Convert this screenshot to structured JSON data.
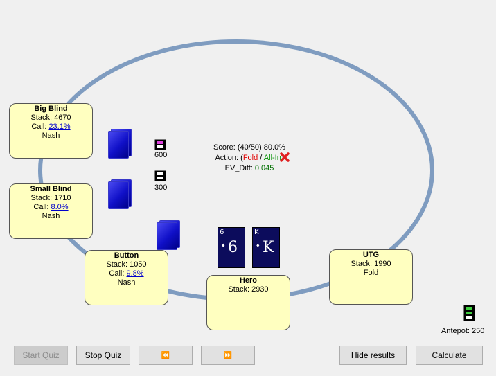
{
  "seats": {
    "big_blind": {
      "name": "Big Blind",
      "stack": "Stack: 4670",
      "call_label": "Call:",
      "call_pct": "23.1%",
      "strategy": "Nash"
    },
    "small_blind": {
      "name": "Small Blind",
      "stack": "Stack: 1710",
      "call_label": "Call:",
      "call_pct": "8.0%",
      "strategy": "Nash"
    },
    "button": {
      "name": "Button",
      "stack": "Stack: 1050",
      "call_label": "Call:",
      "call_pct": "9.8%",
      "strategy": "Nash"
    },
    "hero": {
      "name": "Hero",
      "stack": "Stack: 2930"
    },
    "utg": {
      "name": "UTG",
      "stack": "Stack: 1990",
      "action": "Fold"
    }
  },
  "bets": {
    "big_blind": "600",
    "small_blind": "300"
  },
  "hero_cards": [
    {
      "rank": "6",
      "suit": "♦"
    },
    {
      "rank": "K",
      "suit": "♦"
    }
  ],
  "result": {
    "score": "Score: (40/50) 80.0%",
    "action_prefix": "Action: (",
    "action_fold": "Fold",
    "action_sep": " / ",
    "action_allin": "All-In",
    "action_suffix": ")",
    "ev_label": "EV_Diff:",
    "ev_value": "0.045",
    "result_icon": "red-x-icon"
  },
  "antepot": "Antepot: 250",
  "buttons": {
    "start_quiz": "Start Quiz",
    "stop_quiz": "Stop Quiz",
    "prev": "⏪",
    "next": "⏩",
    "hide_results": "Hide results",
    "calculate": "Calculate"
  },
  "colors": {
    "table_rim": "#7f9cc0",
    "seat_box": "#ffffc0",
    "card_back": "#1a1ad8",
    "fold": "#e00000",
    "allin": "#009000",
    "ev": "#007000"
  }
}
